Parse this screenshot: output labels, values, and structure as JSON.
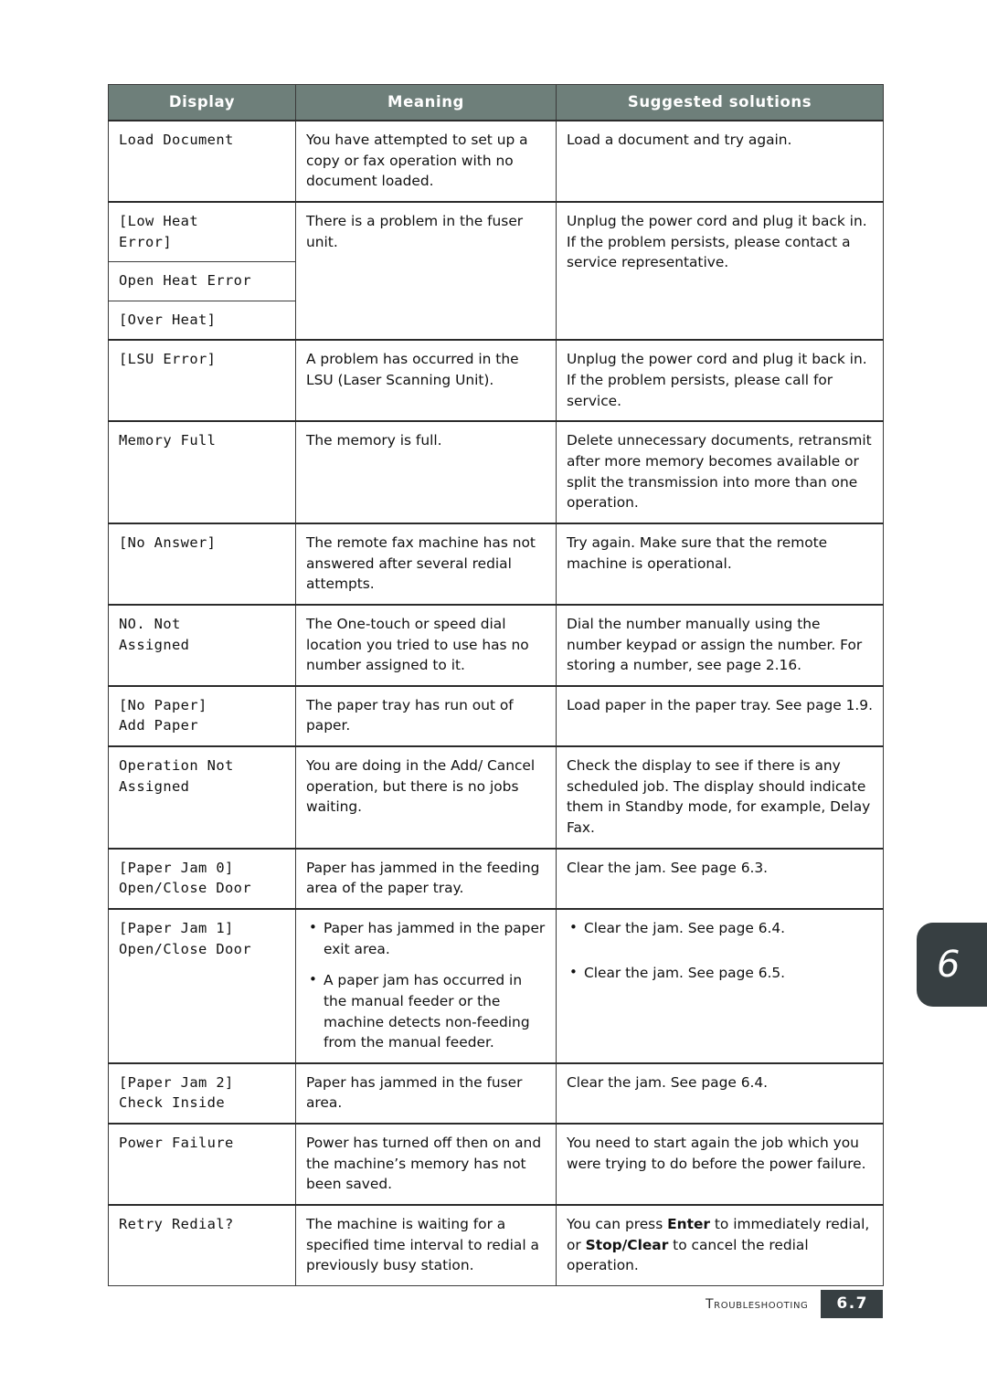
{
  "page": {
    "side_tab_number": "6",
    "footer_label": "Troubleshooting",
    "footer_page": "6.7",
    "accent_header_color": "#6e7f7a",
    "accent_dark_color": "#373f42"
  },
  "table": {
    "headers": {
      "display": "Display",
      "meaning": "Meaning",
      "solutions": "Suggested solutions"
    },
    "rows": [
      {
        "display": "Load Document",
        "meaning": "You have attempted to set up a copy or fax operation with no document loaded.",
        "solution": "Load a document and try again."
      },
      {
        "display": "[Low Heat\nError]",
        "meaning": "There is a problem in the fuser unit.",
        "solution": "Unplug the power cord and plug it back in. If the problem persists, please contact a service representative."
      },
      {
        "display": "Open Heat Error"
      },
      {
        "display": "[Over Heat]"
      },
      {
        "display": "[LSU Error]",
        "meaning": "A problem has occurred in the LSU (Laser Scanning Unit).",
        "solution": "Unplug the power cord and plug it back in. If the problem persists, please call for service."
      },
      {
        "display": "Memory Full",
        "meaning": "The memory is full.",
        "solution": "Delete unnecessary documents, retransmit after more memory becomes available or split the transmission into more than one operation."
      },
      {
        "display": "[No Answer]",
        "meaning": "The remote fax machine has not answered after several redial attempts.",
        "solution": "Try again. Make sure that the remote machine is operational."
      },
      {
        "display": "NO. Not\nAssigned",
        "meaning": "The One-touch or speed dial location you tried to use has no number assigned to it.",
        "solution": "Dial the number manually using the number keypad or assign the number. For storing a number, see page 2.16."
      },
      {
        "display": "[No Paper]\nAdd Paper",
        "meaning": "The paper tray has run out of paper.",
        "solution": "Load paper in the paper tray. See page 1.9."
      },
      {
        "display": "Operation Not\nAssigned",
        "meaning": "You are doing in the Add/ Cancel operation, but there is no jobs waiting.",
        "solution": "Check the display to see if there is any scheduled job. The display should indicate them in Standby mode, for example, Delay Fax."
      },
      {
        "display": "[Paper Jam 0]\nOpen/Close Door",
        "meaning": "Paper has jammed in the feeding area of the paper tray.",
        "solution": "Clear the jam. See page 6.3."
      },
      {
        "display": "[Paper Jam 1]\nOpen/Close Door",
        "meaning_bullets": [
          "Paper has jammed in the paper exit area.",
          "A paper jam has occurred in the manual feeder or the machine detects non-feeding from the manual feeder."
        ],
        "solution_bullets": [
          "Clear the jam. See page 6.4.",
          "Clear the jam. See page 6.5."
        ]
      },
      {
        "display": "[Paper Jam 2]\nCheck Inside",
        "meaning": "Paper has jammed in the fuser area.",
        "solution": "Clear the jam. See page 6.4."
      },
      {
        "display": "Power Failure",
        "meaning": "Power has turned off then on and the machine’s memory has not been saved.",
        "solution": "You need to start again the job which you were trying to do before the power failure."
      },
      {
        "display": "Retry Redial?",
        "meaning": "The machine is waiting for a specified time interval to redial a previously busy station.",
        "solution_parts": [
          {
            "text": "You can press ",
            "bold": false
          },
          {
            "text": "Enter",
            "bold": true
          },
          {
            "text": " to immediately redial, or ",
            "bold": false
          },
          {
            "text": "Stop/Clear",
            "bold": true
          },
          {
            "text": " to cancel the redial operation.",
            "bold": false
          }
        ]
      }
    ]
  }
}
